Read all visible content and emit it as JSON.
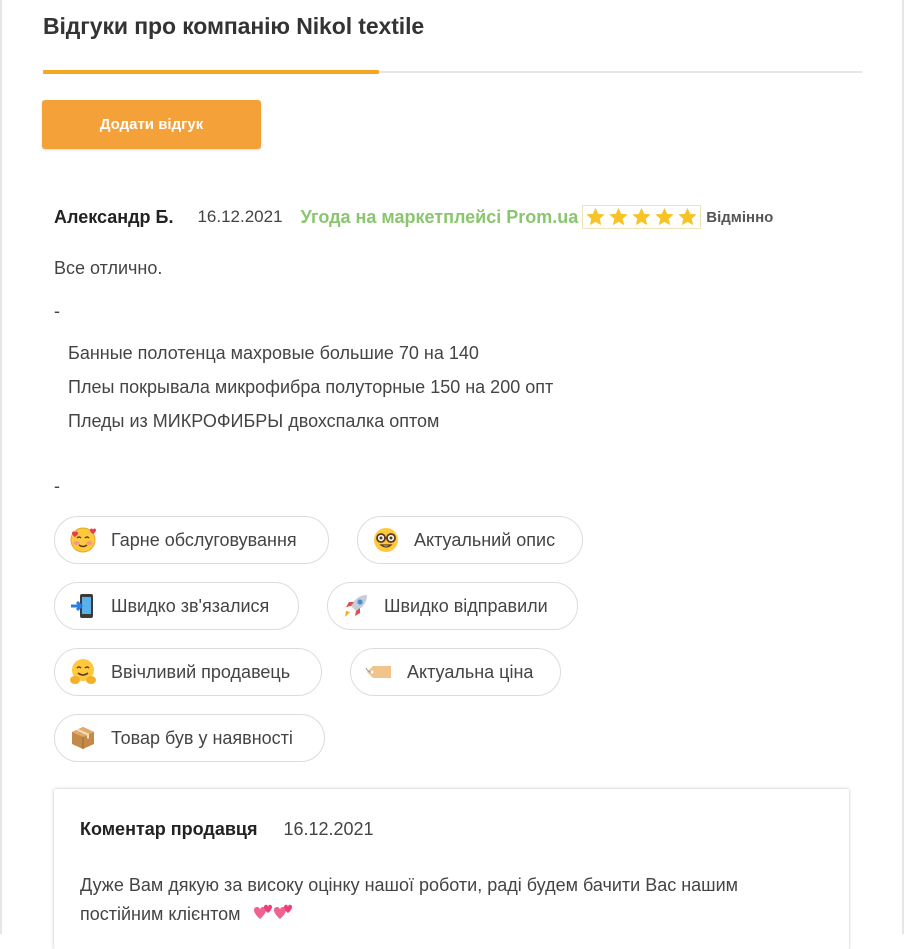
{
  "page": {
    "title": "Відгуки про компанію Nikol textile",
    "add_button": "Додати відгук"
  },
  "review": {
    "author": "Александр Б.",
    "date": "16.12.2021",
    "source": "Угода на маркетплейсі Prom.ua",
    "rating": 5,
    "rating_text": "Відмінно",
    "text": "Все отлично.",
    "separator_1": "-",
    "products": [
      "Банные полотенца махровые большие 70 на 140",
      "Плеы покрывала микрофибра полуторные 150 на 200 опт",
      "Пледы из МИКРОФИБРЫ двохспалка оптом"
    ],
    "separator_2": "-",
    "tags": [
      {
        "icon": "smiling-face-with-hearts-icon",
        "label": "Гарне обслуговування"
      },
      {
        "icon": "nerd-face-icon",
        "label": "Актуальний опис"
      },
      {
        "icon": "mobile-phone-arrow-icon",
        "label": "Швидко зв'язалися"
      },
      {
        "icon": "rocket-icon",
        "label": "Швидко відправили"
      },
      {
        "icon": "hugging-face-icon",
        "label": "Ввічливий продавець"
      },
      {
        "icon": "price-tag-icon",
        "label": "Актуальна ціна"
      },
      {
        "icon": "package-icon",
        "label": "Товар був у наявності"
      }
    ]
  },
  "seller_comment": {
    "title": "Коментар продавця",
    "date": "16.12.2021",
    "text": "Дуже Вам дякую за високу оцінку нашої роботи, раді будем бачити Вас нашим постійним клієнтом",
    "emoji": "two-hearts-icon"
  },
  "colors": {
    "accent": "#f5a13a",
    "tab_active": "#f5a623",
    "source_green": "#8ac66f",
    "star": "#f7c325"
  }
}
